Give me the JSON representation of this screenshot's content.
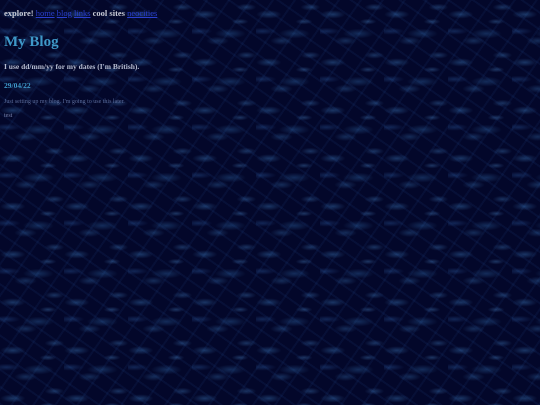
{
  "nav": {
    "explore_label": "explore!",
    "links_1": [
      "home",
      "blog",
      "links"
    ],
    "cool_sites_label": "cool sites",
    "links_2": [
      "neocities"
    ]
  },
  "blog": {
    "title": "My Blog",
    "date_note": "I use dd/mm/yy for my dates (I'm British).",
    "entries": [
      {
        "date": "29/04/22",
        "text": "Just setting up my blog. I'm going to use this later.",
        "extra": "test"
      }
    ]
  },
  "colors": {
    "background": "#03072a",
    "heading": "#3e98c8",
    "link": "#2a3fd0"
  }
}
